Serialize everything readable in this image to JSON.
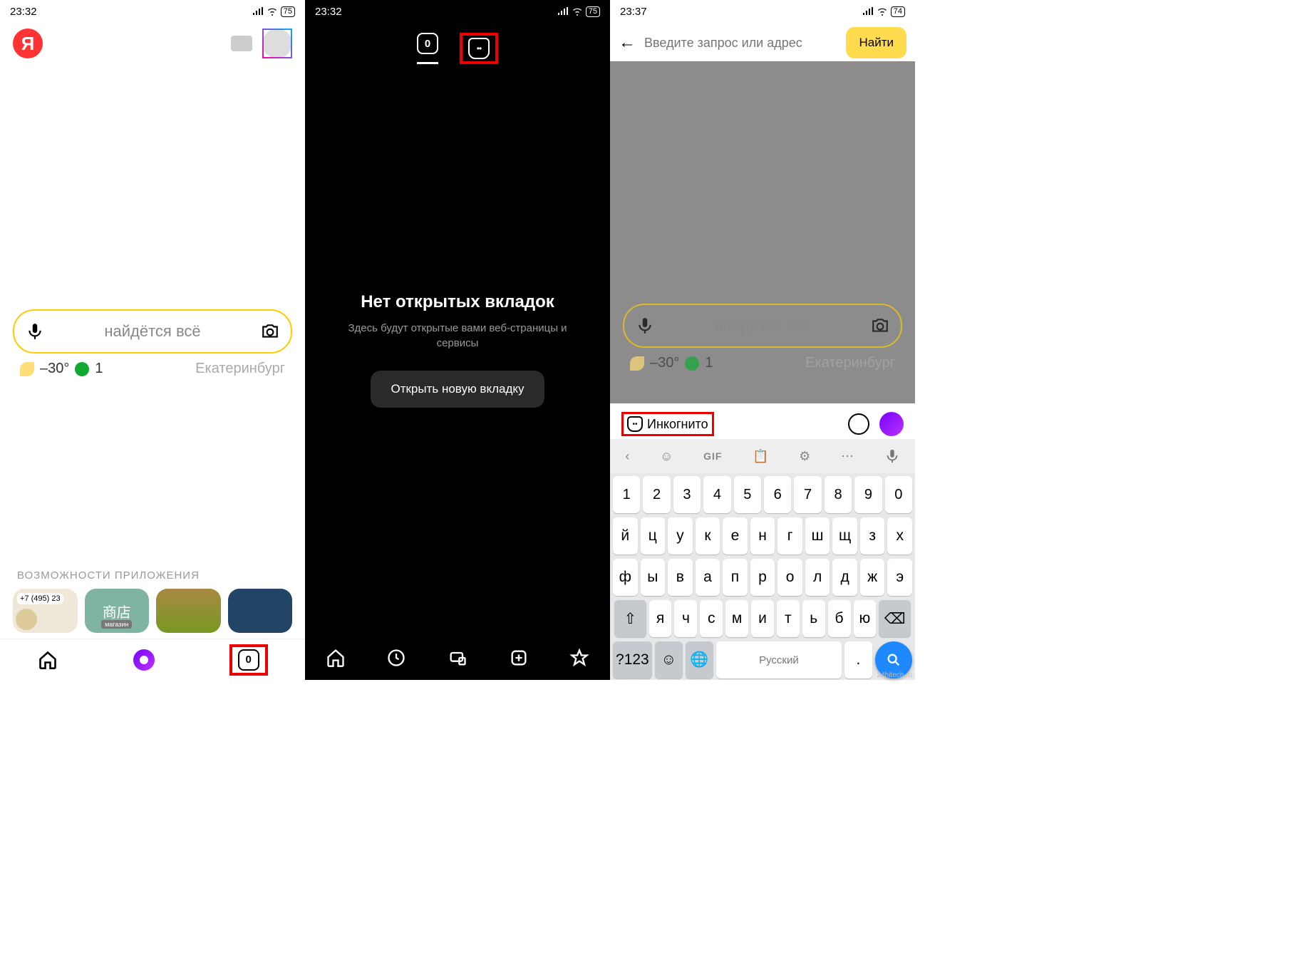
{
  "screen1": {
    "time": "23:32",
    "battery": "75",
    "logo_letter": "Я",
    "search_placeholder": "найдётся всё",
    "weather_temp": "–30°",
    "weather_idx": "1",
    "city": "Екатеринбург",
    "section_title": "ВОЗМОЖНОСТИ ПРИЛОЖЕНИЯ",
    "card_phone": "+7 (495) 23",
    "card_shop": "商店",
    "card_shop_tag": "магазин",
    "tab_count": "0"
  },
  "screen2": {
    "time": "23:32",
    "battery": "75",
    "tab_count": "0",
    "empty_title": "Нет открытых вкладок",
    "empty_sub": "Здесь будут открытые вами веб-страницы и сервисы",
    "open_btn": "Открыть новую вкладку"
  },
  "screen3": {
    "time": "23:37",
    "battery": "74",
    "addr_placeholder": "Введите запрос или адрес",
    "find_btn": "Найти",
    "search_placeholder": "найдётся всё",
    "weather_temp": "–30°",
    "weather_idx": "1",
    "city": "Екатеринбург",
    "incognito": "Инкогнито",
    "gif": "GIF",
    "kb_row_num": [
      "1",
      "2",
      "3",
      "4",
      "5",
      "6",
      "7",
      "8",
      "9",
      "0"
    ],
    "kb_row1": [
      "й",
      "ц",
      "у",
      "к",
      "е",
      "н",
      "г",
      "ш",
      "щ",
      "з",
      "х"
    ],
    "kb_row2": [
      "ф",
      "ы",
      "в",
      "а",
      "п",
      "р",
      "о",
      "л",
      "д",
      "ж",
      "э"
    ],
    "kb_row3": [
      "я",
      "ч",
      "с",
      "м",
      "и",
      "т",
      "ь",
      "б",
      "ю"
    ],
    "kb_sym": "?123",
    "kb_lang": "Русский",
    "kb_dot": "."
  },
  "watermark": "24hitech.ru"
}
